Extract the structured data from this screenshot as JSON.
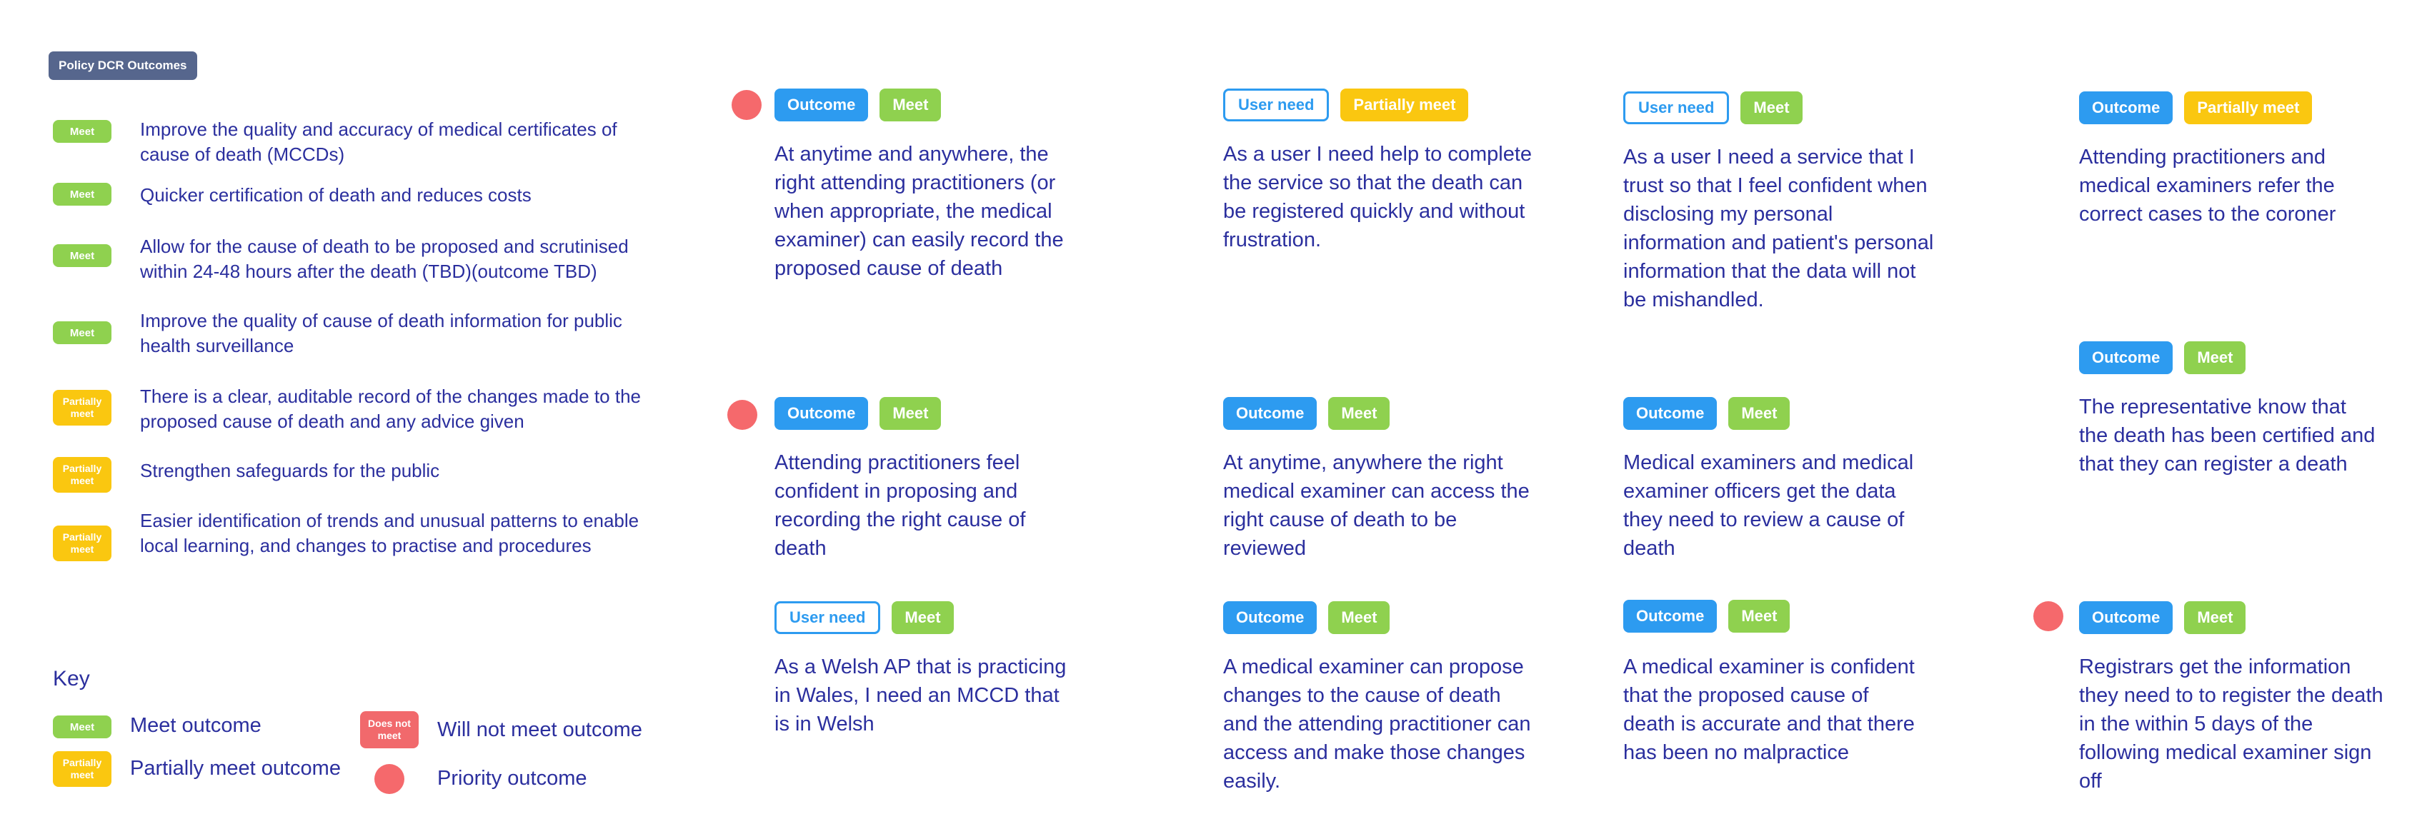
{
  "header": {
    "title": "Policy DCR Outcomes"
  },
  "policy_outcomes": [
    {
      "status": "Meet",
      "text": "Improve the quality and accuracy of medical certificates of cause of death (MCCDs)"
    },
    {
      "status": "Meet",
      "text": "Quicker certification of death and reduces costs"
    },
    {
      "status": "Meet",
      "text": "Allow for the cause of death to be proposed and scrutinised within 24-48 hours after the death (TBD)(outcome TBD)"
    },
    {
      "status": "Meet",
      "text": "Improve the quality of cause of death information for public health surveillance"
    },
    {
      "status": "Partially meet",
      "text": "There is a clear, auditable record of the changes made to the proposed cause of death and any advice given"
    },
    {
      "status": "Partially meet",
      "text": "Strengthen safeguards for the public"
    },
    {
      "status": "Partially meet",
      "text": "Easier identification of trends and unusual patterns to enable local learning, and changes to practise and procedures"
    }
  ],
  "key": {
    "title": "Key",
    "meet_badge": "Meet",
    "meet_label": "Meet outcome",
    "partial_badge": "Partially meet",
    "partial_label": "Partially meet outcome",
    "notmeet_badge": "Does not meet",
    "notmeet_label": "Will not meet outcome",
    "priority_label": "Priority outcome"
  },
  "cards": [
    {
      "type": "Outcome",
      "status": "Meet",
      "priority": true,
      "text": "At anytime and anywhere, the right attending practitioners (or when appropriate, the medical examiner) can easily record the proposed cause of death"
    },
    {
      "type": "User need",
      "status": "Partially meet",
      "priority": false,
      "text": "As a user I need help to complete the service so that the death can be registered quickly and without frustration."
    },
    {
      "type": "User need",
      "status": "Meet",
      "priority": false,
      "text": "As a user I need a service that I trust so that I feel confident when disclosing my personal information and patient's personal information that the data will not be mishandled."
    },
    {
      "type": "Outcome",
      "status": "Partially meet",
      "priority": false,
      "text": "Attending practitioners and medical examiners refer the correct cases to the coroner"
    },
    {
      "type": "Outcome",
      "status": "Meet",
      "priority": false,
      "text": "The representative know that the death has been certified and that they can register a death"
    },
    {
      "type": "Outcome",
      "status": "Meet",
      "priority": true,
      "text": "Attending practitioners feel confident in proposing and recording the right cause of death"
    },
    {
      "type": "Outcome",
      "status": "Meet",
      "priority": false,
      "text": "At anytime, anywhere the right medical examiner can access the right cause of death to be reviewed"
    },
    {
      "type": "Outcome",
      "status": "Meet",
      "priority": false,
      "text": "Medical examiners and medical examiner officers get the data they need to review a cause of death"
    },
    {
      "type": "User need",
      "status": "Meet",
      "priority": false,
      "text": "As a Welsh AP that is practicing in Wales, I need an MCCD that is in Welsh"
    },
    {
      "type": "Outcome",
      "status": "Meet",
      "priority": false,
      "text": "A medical examiner can propose changes to the cause of death and the attending practitioner can access and make those changes easily."
    },
    {
      "type": "Outcome",
      "status": "Meet",
      "priority": false,
      "text": "A medical examiner is confident that the proposed cause of death is accurate and that there has been no malpractice"
    },
    {
      "type": "Outcome",
      "status": "Meet",
      "priority": true,
      "text": "Registrars get the information they need to to register the death in the within 5 days of the following medical examiner sign off"
    }
  ],
  "colors": {
    "meet": "#8fd14f",
    "partial": "#fac710",
    "notmeet": "#f1696c",
    "outcome": "#2d9bf0",
    "header": "#56668d",
    "text": "#2b2f9e",
    "priority": "#f5696c"
  }
}
